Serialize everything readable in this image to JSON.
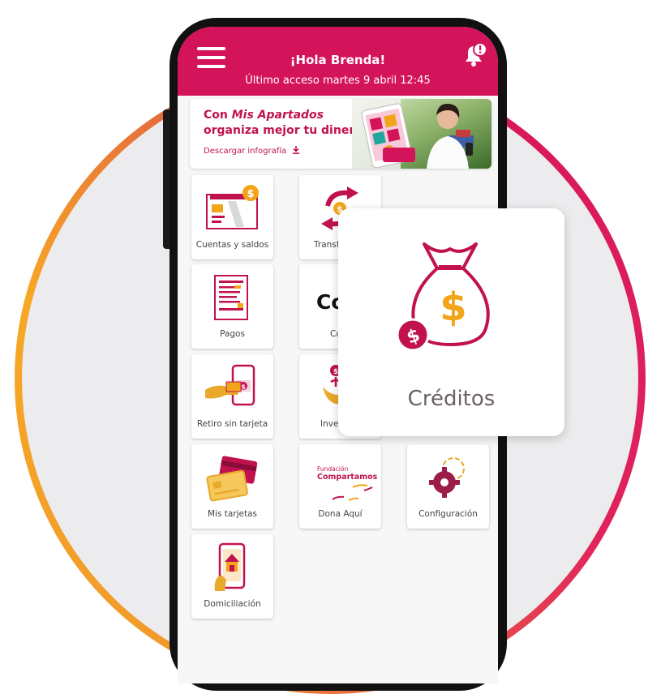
{
  "header": {
    "greeting": "¡Hola Brenda!",
    "last_access": "Último acceso martes 9 abril 12:45"
  },
  "banner": {
    "title_prefix": "Con ",
    "title_italic": "Mis Apartados",
    "title_suffix": "organiza mejor tu dinero",
    "link": "Descargar infografía"
  },
  "tiles": {
    "cuentas": "Cuentas y saldos",
    "transferencias": "Transf",
    "pagos": "Pagos",
    "co": "Co",
    "co_small": "Co",
    "retiro": "Retiro sin tarjeta",
    "inversiones": "Inve",
    "mis_tarjetas": "Mis tarjetas",
    "dona": "Dona Aquí",
    "dona_brand_top": "Fundación",
    "dona_brand": "Compartamos",
    "configuracion": "Configuración",
    "domiciliacion": "Domiciliación"
  },
  "popup": {
    "label": "Créditos"
  },
  "colors": {
    "brand": "#d4145a",
    "accent": "#f2a51a",
    "icon_gold": "#e9a92b"
  }
}
